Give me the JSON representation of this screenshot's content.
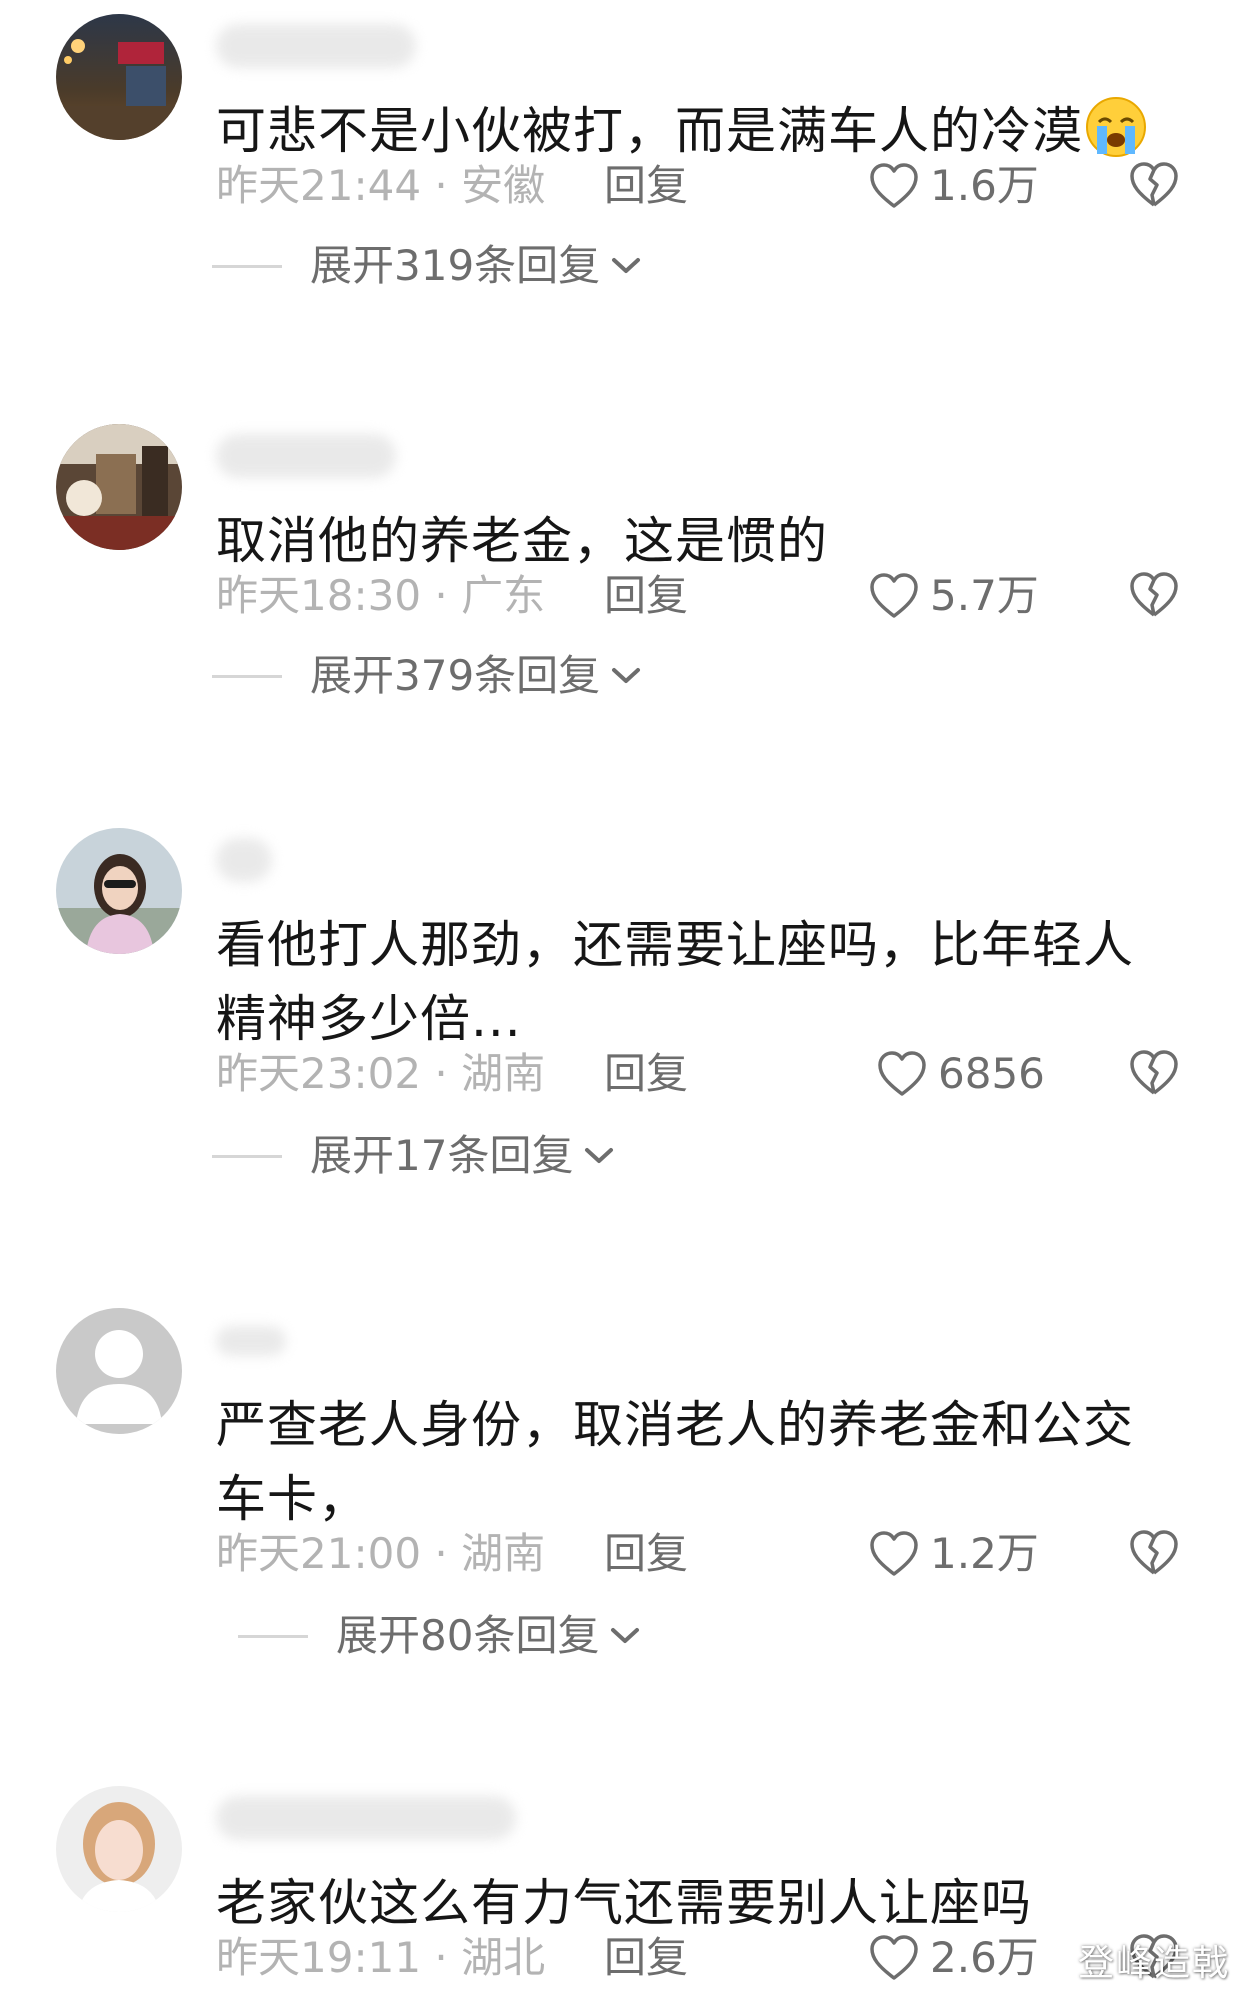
{
  "comments": [
    {
      "text": "可悲不是小伙被打，而是满车人的冷漠",
      "emoji": "crying-face",
      "timestamp": "昨天21:44 · 安徽",
      "reply_label": "回复",
      "likes": "1.6万",
      "expand_label": "展开319条回复"
    },
    {
      "text": "取消他的养老金，这是惯的",
      "timestamp": "昨天18:30 · 广东",
      "reply_label": "回复",
      "likes": "5.7万",
      "expand_label": "展开379条回复"
    },
    {
      "text": "看他打人那劲，还需要让座吗，比年轻人\n精神多少倍...",
      "timestamp": "昨天23:02 · 湖南",
      "reply_label": "回复",
      "likes": "6856",
      "expand_label": "展开17条回复"
    },
    {
      "text": "严查老人身份，取消老人的养老金和公交\n车卡，",
      "timestamp": "昨天21:00 · 湖南",
      "reply_label": "回复",
      "likes": "1.2万",
      "expand_label": "展开80条回复"
    },
    {
      "text": "老家伙这么有力气还需要别人让座吗",
      "timestamp": "昨天19:11 · 湖北",
      "reply_label": "回复",
      "likes": "2.6万"
    }
  ],
  "watermark": "登峰造戟",
  "icons": {
    "like": "heart-outline-icon",
    "dislike": "broken-heart-icon",
    "expand": "chevron-down-icon"
  },
  "colors": {
    "text_primary": "#161616",
    "text_meta": "#b3b3b3",
    "text_secondary": "#6d6d6d",
    "divider": "#d6d6d6"
  }
}
